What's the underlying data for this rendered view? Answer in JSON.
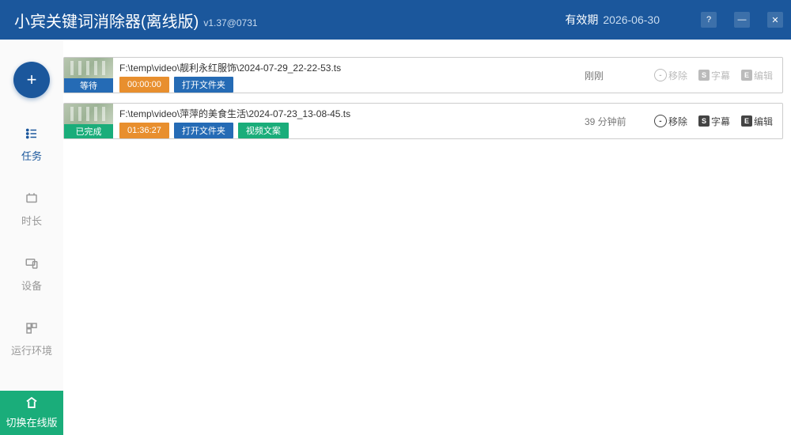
{
  "titlebar": {
    "title": "小宾关键词消除器(离线版)",
    "version": "v1.37@0731",
    "expiry_label": "有效期",
    "expiry_date": "2026-06-30"
  },
  "sidebar": {
    "add_glyph": "+",
    "items": [
      {
        "label": "任务"
      },
      {
        "label": "时长"
      },
      {
        "label": "设备"
      },
      {
        "label": "运行环境"
      }
    ],
    "switch_label": "切换在线版"
  },
  "tasks": [
    {
      "path": "F:\\temp\\video\\靓利永红服饰\\2024-07-29_22-22-53.ts",
      "status_text": "等待",
      "duration": "00:00:00",
      "open_folder": "打开文件夹",
      "clip_text": "",
      "time_text": "刚刚",
      "actions": {
        "remove": "移除",
        "subtitle": "字幕",
        "edit": "编辑"
      }
    },
    {
      "path": "F:\\temp\\video\\萍萍的美食生活\\2024-07-23_13-08-45.ts",
      "status_text": "已完成",
      "duration": "01:36:27",
      "open_folder": "打开文件夹",
      "clip_text": "视频文案",
      "time_text": "39 分钟前",
      "actions": {
        "remove": "移除",
        "subtitle": "字幕",
        "edit": "编辑"
      }
    }
  ]
}
